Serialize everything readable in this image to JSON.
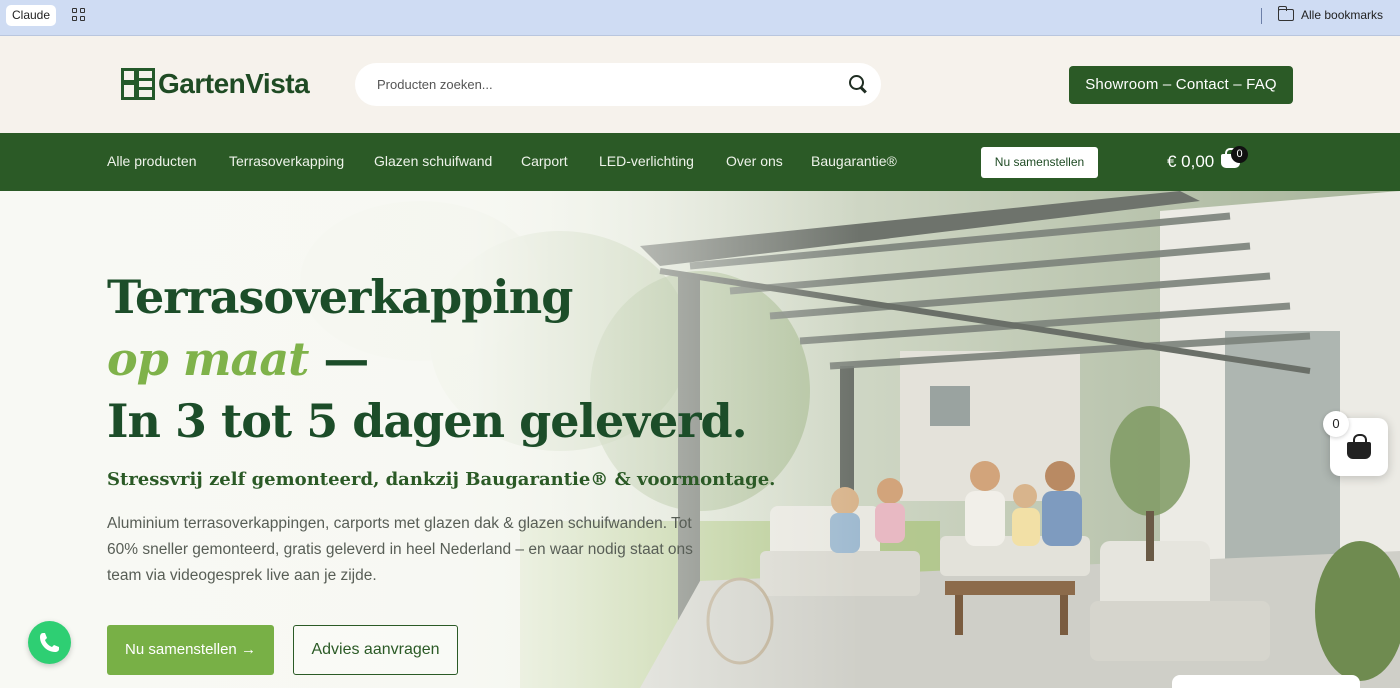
{
  "browser": {
    "profile_chip": "Claude",
    "bookmarks_label": "Alle bookmarks"
  },
  "header": {
    "logo_text": "GartenVista",
    "search_placeholder": "Producten zoeken...",
    "contact_button": "Showroom – Contact – FAQ"
  },
  "nav": {
    "items": [
      "Alle producten",
      "Terrasoverkapping",
      "Glazen schuifwand",
      "Carport",
      "LED-verlichting",
      "Over ons",
      "Baugarantie®"
    ],
    "cta": "Nu samenstellen",
    "cart_total": "€ 0,00",
    "cart_count": "0"
  },
  "hero": {
    "title_line1": "Terrasoverkapping",
    "title_line2_accent": "op maat",
    "title_line2_dash": " —",
    "title_line3": "In 3 tot 5 dagen geleverd.",
    "subtitle": "Stressvrij zelf gemonteerd, dankzij Baugarantie® & voormontage.",
    "description": "Aluminium terrasoverkappingen, carports met glazen dak & glazen schuifwanden. Tot 60% sneller gemonteerd, gratis geleverd in heel Nederland – en waar nodig staat ons team via videogesprek live aan je zijde.",
    "primary_button": "Nu samenstellen →",
    "secondary_button": "Advies aanvragen"
  },
  "floating": {
    "cart_count": "0"
  },
  "colors": {
    "brand_green": "#2b5a26",
    "accent_green": "#78b046",
    "heading_green": "#1c4d29",
    "whatsapp_green": "#2ecf73",
    "bookmarks_bar": "#cfdcf3"
  }
}
